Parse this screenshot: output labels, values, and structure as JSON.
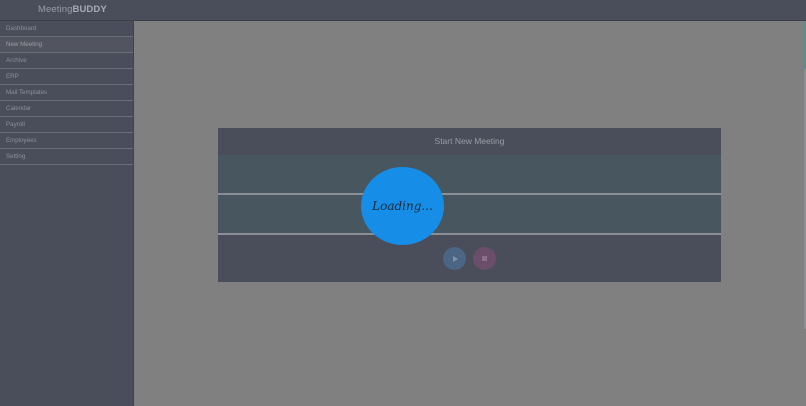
{
  "brand": {
    "light": "Meeting",
    "bold": "BUDDY"
  },
  "sidebar": {
    "items": [
      {
        "label": "Dashboard"
      },
      {
        "label": "New Meeting"
      },
      {
        "label": "Archive"
      },
      {
        "label": "ERP"
      },
      {
        "label": "Mail Templates"
      },
      {
        "label": "Calendar"
      },
      {
        "label": "Payroll"
      },
      {
        "label": "Employees"
      },
      {
        "label": "Setting"
      }
    ],
    "active_index": 1
  },
  "modal": {
    "title": "Start New Meeting",
    "controls": {
      "play_icon": "play-icon",
      "stop_icon": "stop-icon"
    }
  },
  "loader": {
    "text": "Loading..."
  },
  "colors": {
    "topbar": "#4a4d5a",
    "sidebar": "#4a4d5a",
    "overlay": "#7f7f7f",
    "loader": "#168de6",
    "play": "#4b6585",
    "stop": "#6b4e6a"
  }
}
